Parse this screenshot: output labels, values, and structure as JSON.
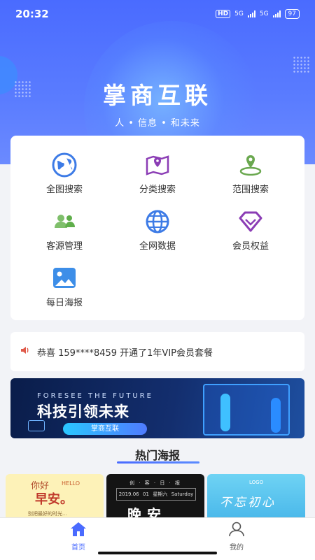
{
  "status_bar": {
    "time": "20:32",
    "hd": "HD",
    "net1": "5G",
    "net2": "5G",
    "battery": "97"
  },
  "header": {
    "title": "掌商互联",
    "subtitle": "人 • 信息 • 和未来"
  },
  "grid": [
    {
      "label": "全图搜索",
      "icon": "globe-icon"
    },
    {
      "label": "分类搜索",
      "icon": "map-pin-icon"
    },
    {
      "label": "范围搜索",
      "icon": "location-range-icon"
    },
    {
      "label": "客源管理",
      "icon": "users-icon"
    },
    {
      "label": "全网数据",
      "icon": "web-icon"
    },
    {
      "label": "会员权益",
      "icon": "diamond-icon"
    },
    {
      "label": "每日海报",
      "icon": "image-icon"
    }
  ],
  "notice": {
    "text": "恭喜 159****8459 开通了1年VIP会员套餐"
  },
  "banner": {
    "english": "FORESEE THE FUTURE",
    "headline": "科技引领未来",
    "button": "掌商互联"
  },
  "posters_section": {
    "title": "热门海报",
    "posters": [
      {
        "greeting": "你好",
        "hello": "HELLO",
        "main": "早安。",
        "footer": "别把最好的时光..."
      },
      {
        "top": "创 · 客 · 日 · 报",
        "date": "2019.06",
        "month": "June",
        "day": "01",
        "weekday": "星期六",
        "weekday_en": "Saturday",
        "big": "晚安"
      },
      {
        "logo": "LOGO",
        "handwriting": "不忘初心"
      }
    ]
  },
  "tabbar": {
    "tabs": [
      {
        "label": "首页",
        "active": true
      },
      {
        "label": "我的",
        "active": false
      }
    ]
  },
  "colors": {
    "accent": "#4a6bff",
    "card_bg": "#ffffff",
    "page_bg": "#f2f3f7"
  }
}
